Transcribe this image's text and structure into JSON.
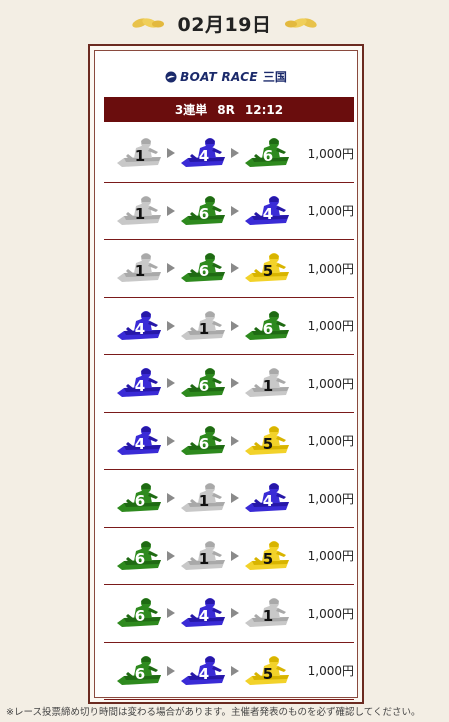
{
  "header": {
    "date": "02月19日",
    "ornament_icon": "laurel-wing-icon"
  },
  "logo": {
    "text": "BOAT RACE",
    "venue": "三国",
    "icon": "boat-race-logo-icon"
  },
  "race": {
    "bet_type": "3連単",
    "race_no": "8R",
    "time": "12:12"
  },
  "boat_colors": {
    "1": {
      "body": "#c8c8c8",
      "shade": "#a9a9a9",
      "text": "#111111"
    },
    "4": {
      "body": "#3a2bd6",
      "shade": "#2617a8",
      "text": "#ffffff"
    },
    "5": {
      "body": "#f2d22a",
      "shade": "#d8b400",
      "text": "#111111"
    },
    "6": {
      "body": "#2e8a1e",
      "shade": "#1f6a13",
      "text": "#ffffff"
    }
  },
  "bets": [
    {
      "boats": [
        "1",
        "4",
        "6"
      ],
      "amount": "1,000円"
    },
    {
      "boats": [
        "1",
        "6",
        "4"
      ],
      "amount": "1,000円"
    },
    {
      "boats": [
        "1",
        "6",
        "5"
      ],
      "amount": "1,000円"
    },
    {
      "boats": [
        "4",
        "1",
        "6"
      ],
      "amount": "1,000円"
    },
    {
      "boats": [
        "4",
        "6",
        "1"
      ],
      "amount": "1,000円"
    },
    {
      "boats": [
        "4",
        "6",
        "5"
      ],
      "amount": "1,000円"
    },
    {
      "boats": [
        "6",
        "1",
        "4"
      ],
      "amount": "1,000円"
    },
    {
      "boats": [
        "6",
        "1",
        "5"
      ],
      "amount": "1,000円"
    },
    {
      "boats": [
        "6",
        "4",
        "1"
      ],
      "amount": "1,000円"
    },
    {
      "boats": [
        "6",
        "4",
        "5"
      ],
      "amount": "1,000円"
    }
  ],
  "footnote": "※レース投票締め切り時間は変わる場合があります。主催者発表のものを必ず確認してください。"
}
